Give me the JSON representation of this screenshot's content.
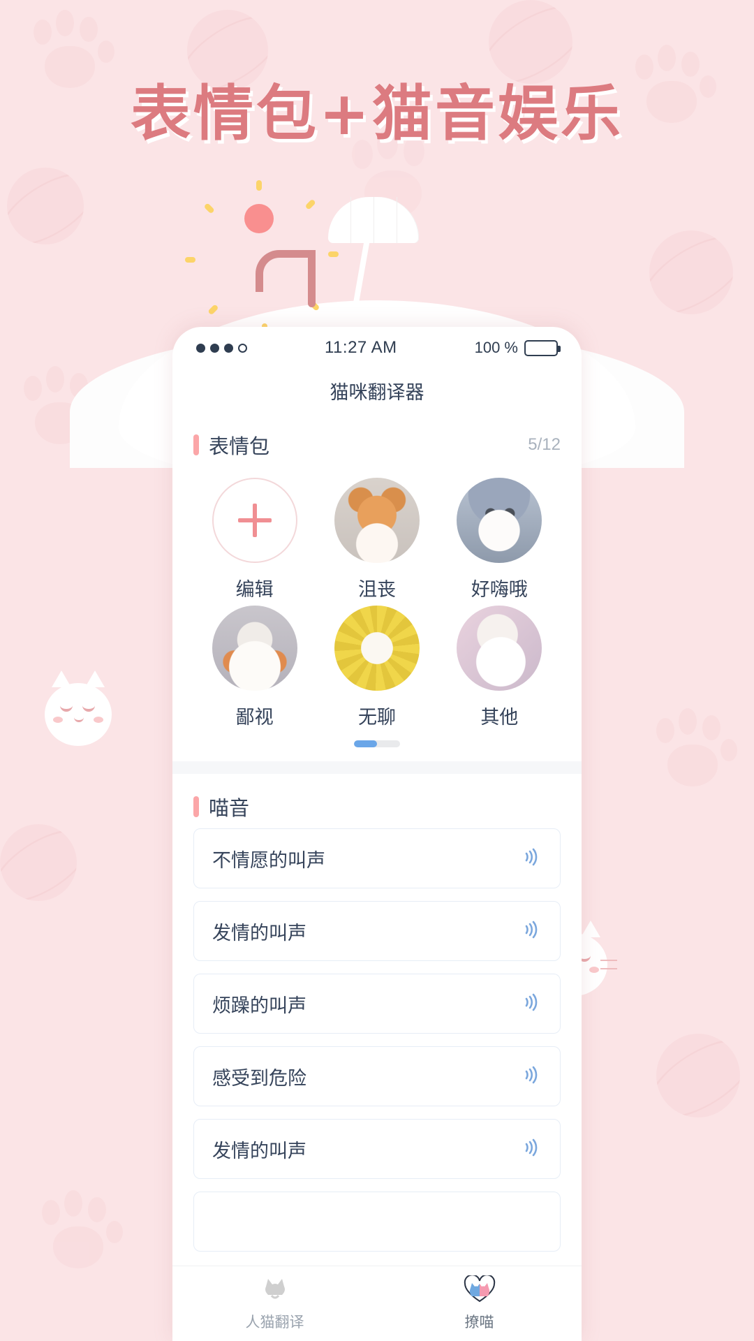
{
  "poster": {
    "headline": "表情包+猫音娱乐",
    "background_color": "#fbe4e6",
    "headline_color": "#dc7b80"
  },
  "statusbar": {
    "signal_icon": "signal-dots-icon",
    "time": "11:27 AM",
    "battery_level": "100 %",
    "battery_icon": "battery-full-icon"
  },
  "navbar": {
    "title": "猫咪翻译器"
  },
  "emoji_section": {
    "title": "表情包",
    "counter": "5/12",
    "items": [
      {
        "label": "编辑",
        "thumb": "add-plus-icon"
      },
      {
        "label": "沮丧",
        "thumb": "cat-photo-orange"
      },
      {
        "label": "好嗨哦",
        "thumb": "cat-photo-grey-hat"
      },
      {
        "label": "鄙视",
        "thumb": "cat-photo-orange-white"
      },
      {
        "label": "无聊",
        "thumb": "cat-photo-sunflower"
      },
      {
        "label": "其他",
        "thumb": "cat-photo-white-fluffy"
      }
    ],
    "pager": {
      "pages": 2,
      "current": 1,
      "active_color": "#6aa6e8"
    }
  },
  "sound_section": {
    "title": "喵音",
    "accent_color": "#fba6a8",
    "items": [
      {
        "label": "不情愿的叫声",
        "icon": "speaker-wave-icon"
      },
      {
        "label": "发情的叫声",
        "icon": "speaker-wave-icon"
      },
      {
        "label": "烦躁的叫声",
        "icon": "speaker-wave-icon"
      },
      {
        "label": "感受到危险",
        "icon": "speaker-wave-icon"
      },
      {
        "label": "发情的叫声",
        "icon": "speaker-wave-icon"
      }
    ]
  },
  "tabbar": {
    "tabs": [
      {
        "label": "人猫翻译",
        "icon": "cat-silhouette-icon",
        "active": false
      },
      {
        "label": "撩喵",
        "icon": "two-cats-heart-icon",
        "active": true
      }
    ]
  }
}
